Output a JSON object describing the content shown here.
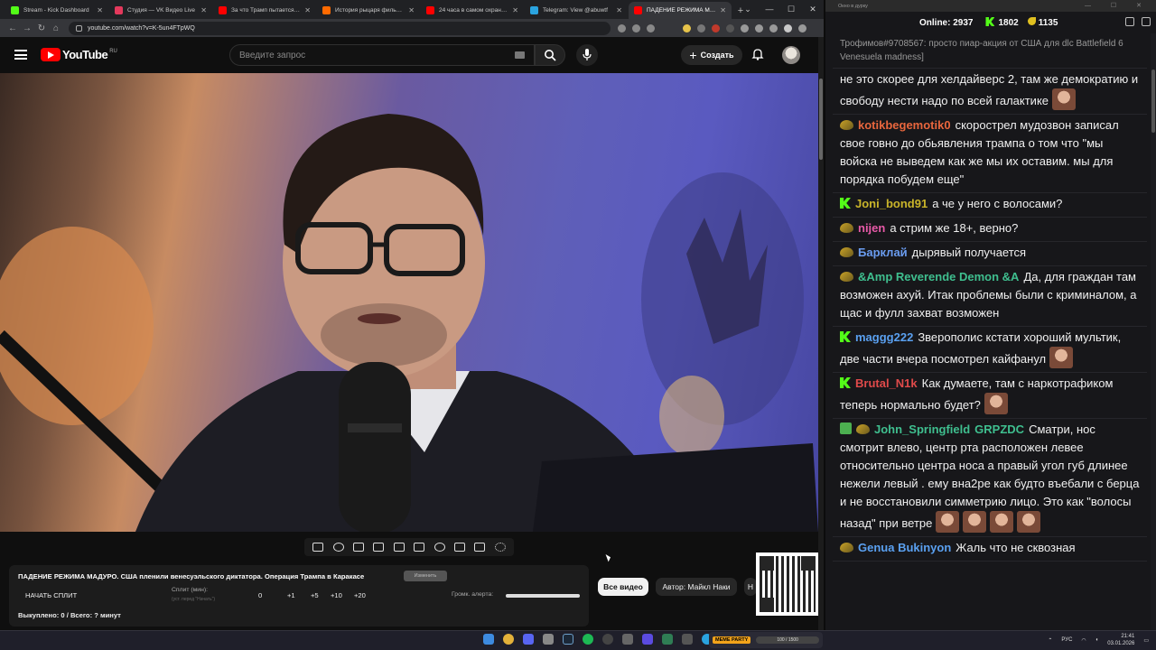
{
  "browser": {
    "tabs": [
      {
        "title": "Stream - Kick Dashboard",
        "color": "#53fc18",
        "active": false
      },
      {
        "title": "Студия — VK Видео Live",
        "color": "#e4395c",
        "active": false
      },
      {
        "title": "За что Трамп пытается убить",
        "color": "#ff0000",
        "active": false
      },
      {
        "title": "История рыцаря фильм, 2001",
        "color": "#ff6a00",
        "active": false
      },
      {
        "title": "24 часа в самом охраняемом",
        "color": "#ff0000",
        "active": false
      },
      {
        "title": "Telegram: View @abuwtf",
        "color": "#2aa3df",
        "active": false
      },
      {
        "title": "ПАДЕНИЕ РЕЖИМА МАДУРО",
        "color": "#ff0000",
        "active": true
      }
    ],
    "url": "youtube.com/watch?v=K-5un4FTpWQ"
  },
  "youtube": {
    "logo_text": "YouTube",
    "country": "RU",
    "search_placeholder": "Введите запрос",
    "create_label": "Создать",
    "create_plus": "+"
  },
  "panel": {
    "video_title": "ПАДЕНИЕ РЕЖИМА МАДУРО. США пленили венесуэльского диктатора. Операция Трампа в Каракасе",
    "chip": "Изменить",
    "split_button": "НАЧАТЬ СПЛИТ",
    "split_label": "Сплит (мин):",
    "split_hint": "(уст. перед \"Начать\")",
    "split_value": "0",
    "increments": [
      "+1",
      "+5",
      "+10",
      "+20"
    ],
    "volume_label": "Громк. алерта:",
    "volume_level": 1,
    "bought": "Выкуплено: 0 / Всего: ? минут"
  },
  "filters": {
    "all": "Все видео",
    "author": "Автор: Майкл Наки",
    "next": "Н"
  },
  "chat": {
    "window_title": "Окно в дурку",
    "online_label": "Online:",
    "online_value": "2937",
    "kick_count": "1802",
    "sub_count": "1135",
    "messages": [
      {
        "badges": [],
        "nick": "",
        "nick_color": "#999999",
        "text": "Трофимов#9708567: просто пиар-акция от США для dlc Battlefield 6 Venesuela madness]",
        "emotes": 0,
        "cls": "top"
      },
      {
        "badges": [],
        "nick": "",
        "nick_color": "#ffffff",
        "text": "не это скорее для хелдайверс 2, там же демократию и свободу нести надо по всей галактике",
        "emotes": 1
      },
      {
        "badges": [
          "sub"
        ],
        "nick": "kotikbegemotik0",
        "nick_color": "#e8663d",
        "text": "скорострел мудозвон записал свое говно до обьявления трампа о том что \"мы войска не выведем как же мы их оставим. мы для порядка побудем еще\"",
        "emotes": 0
      },
      {
        "badges": [
          "kick"
        ],
        "nick": "Joni_bond91",
        "nick_color": "#c9b42a",
        "text": "а че у него с волосами?",
        "emotes": 0
      },
      {
        "badges": [
          "sub"
        ],
        "nick": "nijen",
        "nick_color": "#e85aa8",
        "text": "а стрим же 18+, верно?",
        "emotes": 0
      },
      {
        "badges": [
          "sub"
        ],
        "nick": "Барклай",
        "nick_color": "#6a9cf0",
        "text": "дырявый получается",
        "emotes": 0
      },
      {
        "badges": [
          "sub"
        ],
        "nick": "&Amp Reverende Demon &A",
        "nick_color": "#3fbf8f",
        "text": "Да, для граждан там возможен ахуй. Итак проблемы были с криминалом, а щас и фулл захват возможен",
        "emotes": 0
      },
      {
        "badges": [
          "kick"
        ],
        "nick": "maggg222",
        "nick_color": "#5aa0f0",
        "text": "Зверополис кстати хороший мультик, две части вчера посмотрел кайфанул",
        "emotes": 1
      },
      {
        "badges": [
          "kick"
        ],
        "nick": "Brutal_N1k",
        "nick_color": "#e04a4a",
        "text": "Как думаете, там с наркотрафиком теперь нормально будет?",
        "emotes": 1
      },
      {
        "badges": [
          "check",
          "sub"
        ],
        "nick": "John_Springfield",
        "nick_color": "#3fbf8f",
        "extra_nick": "GRPZDC",
        "text": "Сматри, нос смотрит влево, центр рта расположен левее относительно центра носа а правый угол губ длинее нежели левый . ему вна2ре как будто въебали с берца и не восстановили симметрию лицо. Это как \"волосы назад\" при ветре",
        "emotes": 4
      },
      {
        "badges": [
          "sub"
        ],
        "nick": "Genua Bukinyon",
        "nick_color": "#5aa0f0",
        "text": "Жаль что не сквозная",
        "emotes": 0
      }
    ]
  },
  "taskbar": {
    "meme_label": "MEME PARTY",
    "meme_progress": "100 / 1500",
    "lang": "РУС",
    "time": "21:41",
    "date": "03.01.2026"
  }
}
